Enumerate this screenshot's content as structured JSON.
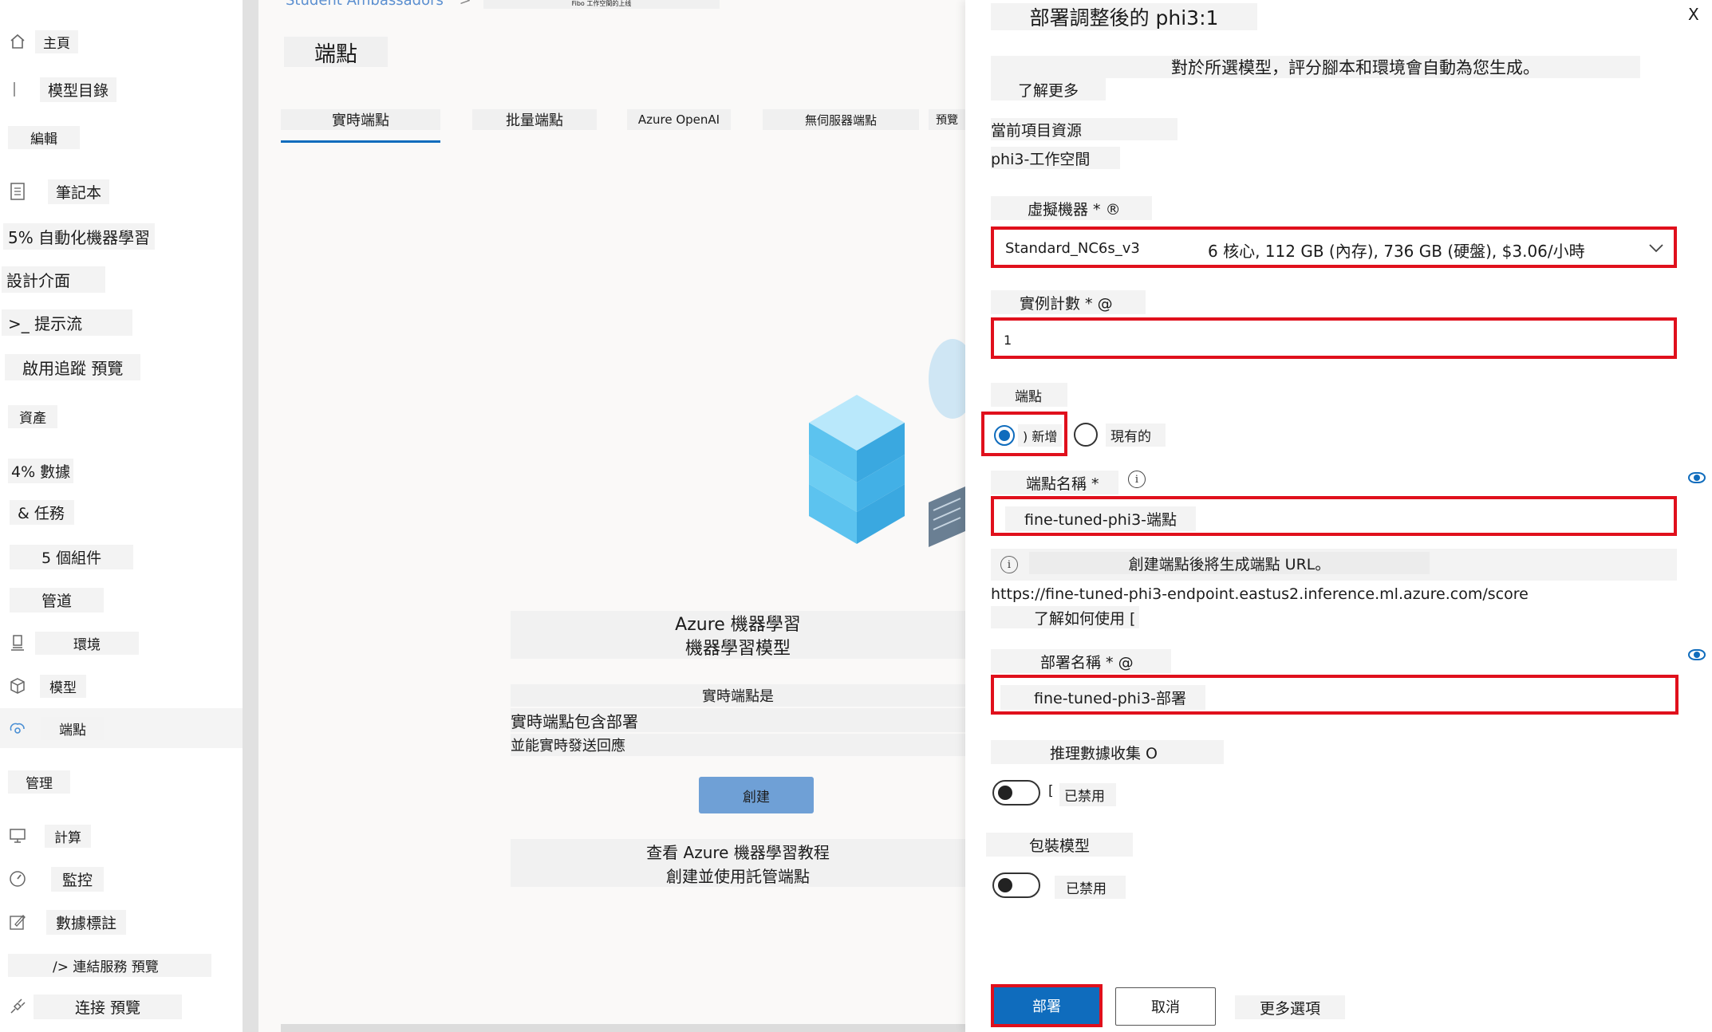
{
  "sidebar": {
    "items": [
      {
        "label": "主頁",
        "icon": "home-icon"
      },
      {
        "label": "模型目錄",
        "icon": "catalog-icon"
      },
      {
        "label": "編輯",
        "icon": ""
      },
      {
        "label": "筆記本",
        "icon": "notebook-icon"
      },
      {
        "label": "5% 自動化機器學習",
        "icon": ""
      },
      {
        "label": "設計介面",
        "icon": ""
      },
      {
        "label": ">_ 提示流",
        "icon": ""
      },
      {
        "label": "啟用追蹤 預覽",
        "icon": ""
      },
      {
        "label": "資產",
        "icon": ""
      },
      {
        "label": "4% 數據",
        "icon": ""
      },
      {
        "label": "& 任務",
        "icon": ""
      },
      {
        "label": "5 個組件",
        "icon": ""
      },
      {
        "label": "管道",
        "icon": ""
      },
      {
        "label": "環境",
        "icon": "environment-icon"
      },
      {
        "label": "模型",
        "icon": "model-cube-icon"
      },
      {
        "label": "端點",
        "icon": "endpoint-icon"
      },
      {
        "label": "管理",
        "icon": ""
      },
      {
        "label": "計算",
        "icon": "compute-monitor-icon"
      },
      {
        "label": "監控",
        "icon": "gauge-icon"
      },
      {
        "label": "數據標註",
        "icon": "edit-label-icon"
      },
      {
        "label": "/> 連結服務 預覽",
        "icon": ""
      },
      {
        "label": "连接 預覽",
        "icon": "plug-icon"
      }
    ]
  },
  "main": {
    "breadcrumb": {
      "root": "Student Ambassadors",
      "separator": ">",
      "current": "Fibo 工作空間的上线"
    },
    "page_title": "端點",
    "tabs": [
      {
        "label": "實時端點"
      },
      {
        "label": "批量端點"
      },
      {
        "label": "Azure OpenAI"
      },
      {
        "label": "無伺服器端點"
      },
      {
        "label": "預覽"
      }
    ],
    "promo": {
      "title_line1": "Azure 機器學習",
      "title_line2": "機器學習模型",
      "desc_line1": "實時端點是",
      "desc_line2": "實時端點包含部署",
      "desc_line3": "並能實時發送回應",
      "create_button": "創建",
      "tutorial_line1": "查看 Azure 機器學習教程",
      "tutorial_line2": "創建並使用託管端點"
    }
  },
  "panel": {
    "title": "部署調整後的 phi3:1",
    "close": "X",
    "description": "對於所選模型，評分腳本和環境會自動為您生成。",
    "learn_more": "了解更多",
    "project_resource_label": "當前項目資源",
    "project_resource_value": "phi3-工作空間",
    "vm_label": "虛擬機器 * ®",
    "vm_value": "Standard_NC6s_v3",
    "vm_specs": "6 核心, 112 GB (內存), 736 GB (硬盤), $3.06/小時",
    "instance_count_label": "實例計數 * @",
    "instance_count_value": "1",
    "endpoint_label": "端點",
    "radio_new": ") 新增",
    "radio_existing": "現有的",
    "endpoint_name_label": "端點名稱 *",
    "endpoint_name_value": "fine-tuned-phi3-端點",
    "endpoint_info": "創建端點後將生成端點 URL。",
    "endpoint_url": "https://fine-tuned-phi3-endpoint.eastus2.inference.ml.azure.com/score",
    "learn_usage": "了解如何使用 [",
    "deployment_name_label": "部署名稱 * @",
    "deployment_name_value": "fine-tuned-phi3-部署",
    "inference_label": "推理數據收集 O",
    "inference_toggle_bracket": "[",
    "inference_state": "已禁用",
    "package_label": "包裝模型",
    "package_state": "已禁用",
    "deploy_button": "部署",
    "cancel_button": "取消",
    "more_options": "更多選項"
  },
  "colors": {
    "accent": "#0f6cbd",
    "highlight": "#e0101c",
    "create_button": "#6fa0d6"
  }
}
